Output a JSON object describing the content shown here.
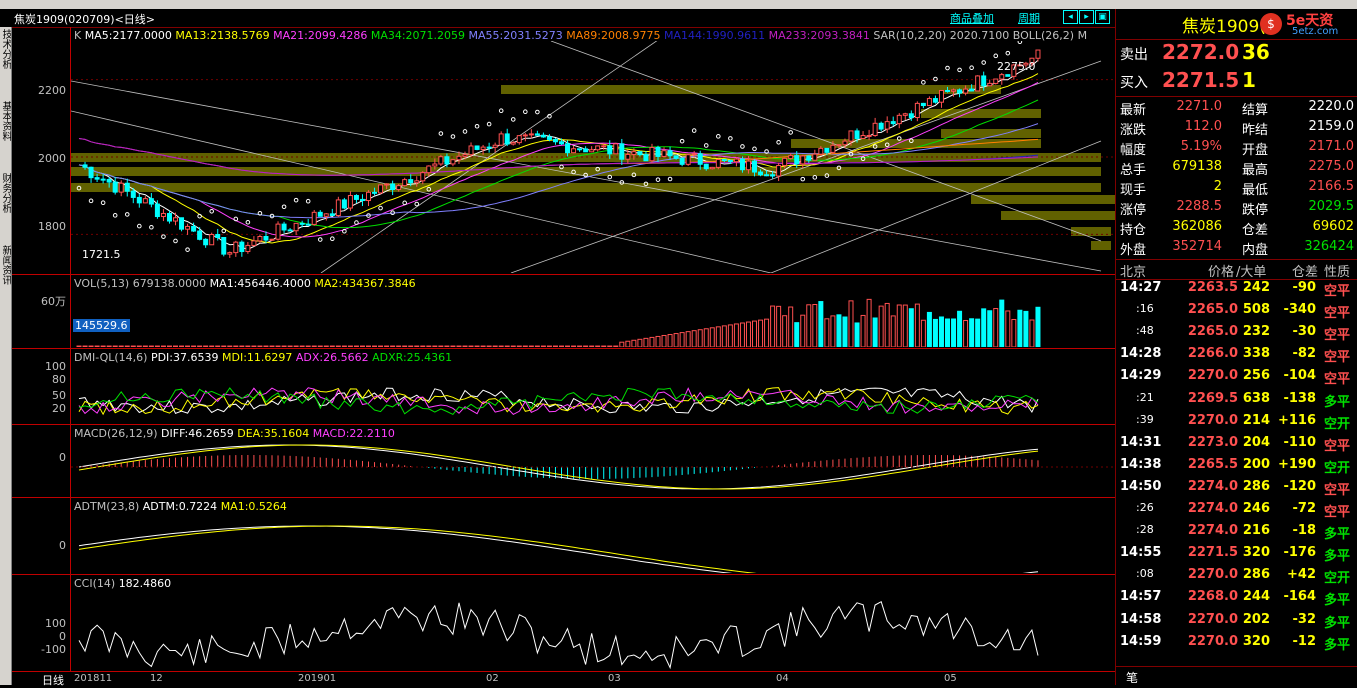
{
  "title": {
    "name": "焦炭1909",
    "code": "(020709)",
    "period": "<日线>"
  },
  "toolbar": {
    "product_overlay": "商品叠加",
    "cycle": "周期"
  },
  "sidebar": {
    "tabs": [
      "技术分析",
      "基本资料",
      "财务分析",
      "新闻资讯"
    ]
  },
  "main_chart": {
    "indicator_line": [
      {
        "text": "K",
        "color": "#c0c0c0"
      },
      {
        "text": "MA5:2177.0000",
        "color": "#ffffff"
      },
      {
        "text": "MA13:2138.5769",
        "color": "#ffff00"
      },
      {
        "text": "MA21:2099.4286",
        "color": "#ff40ff"
      },
      {
        "text": "MA34:2071.2059",
        "color": "#00e000"
      },
      {
        "text": "MA55:2031.5273",
        "color": "#8080ff"
      },
      {
        "text": "MA89:2008.9775",
        "color": "#ff8000"
      },
      {
        "text": "MA144:1990.9611",
        "color": "#2020c0"
      },
      {
        "text": "MA233:2093.3841",
        "color": "#c020c0"
      },
      {
        "text": "SAR(10,2,20) 2020.7100",
        "color": "#c0c0c0"
      },
      {
        "text": "BOLL(26,2) M",
        "color": "#c0c0c0"
      }
    ],
    "y_ticks": [
      "2200",
      "2000",
      "1800"
    ],
    "high_label": "2275.0",
    "low_label": "1721.5"
  },
  "volume": {
    "header": "VOL(5,13) 679138.0000",
    "ma1": "MA1:456446.4000",
    "ma2": "MA2:434367.3846",
    "y_tick": "60万",
    "cursor_value": "145529.6"
  },
  "dmi": {
    "header": "DMI-QL(14,6)",
    "pdi": "PDI:37.6539",
    "mdi": "MDI:11.6297",
    "adx": "ADX:26.5662",
    "adxr": "ADXR:25.4361",
    "y_ticks": [
      "100",
      "80",
      "50",
      "20"
    ]
  },
  "macd": {
    "header": "MACD(26,12,9)",
    "diff": "DIFF:46.2659",
    "dea": "DEA:35.1604",
    "macd": "MACD:22.2110",
    "y_tick": "0"
  },
  "adtm": {
    "header": "ADTM(23,8)",
    "adtm": "ADTM:0.7224",
    "ma1": "MA1:0.5264",
    "y_tick": "0"
  },
  "cci": {
    "header": "CCI(14)",
    "value": "182.4860",
    "y_ticks": [
      "100",
      "0",
      "-100"
    ]
  },
  "x_axis": {
    "corner": "日线",
    "labels": [
      "201811",
      "12",
      "201901",
      "02",
      "03",
      "04",
      "05"
    ]
  },
  "quote": {
    "title": "焦炭1909(",
    "logo": "5e天资",
    "logo_sub": "5etz.com",
    "sell_label": "卖出",
    "sell_price": "2272.0",
    "sell_vol": "36",
    "buy_label": "买入",
    "buy_price": "2271.5",
    "buy_vol": "1",
    "fields": [
      [
        "最新",
        "2271.0",
        "red",
        "结算",
        "2220.0",
        "white"
      ],
      [
        "涨跌",
        "112.0",
        "red",
        "昨结",
        "2159.0",
        "white"
      ],
      [
        "幅度",
        "5.19%",
        "red",
        "开盘",
        "2171.0",
        "red"
      ],
      [
        "总手",
        "679138",
        "yellow",
        "最高",
        "2275.0",
        "red"
      ],
      [
        "现手",
        "2",
        "yellow",
        "最低",
        "2166.5",
        "red"
      ],
      [
        "涨停",
        "2288.5",
        "red",
        "跌停",
        "2029.5",
        "green"
      ],
      [
        "持仓",
        "362086",
        "yellow",
        "仓差",
        "69602",
        "yellow"
      ],
      [
        "外盘",
        "352714",
        "red",
        "内盘",
        "326424",
        "green"
      ]
    ],
    "tick_header": [
      "北京",
      "价格",
      "/大单",
      "仓差",
      "性质"
    ],
    "ticks": [
      [
        "14:27",
        "2263.5",
        "242",
        "-90",
        "空平",
        "red"
      ],
      [
        ":16",
        "2265.0",
        "508",
        "-340",
        "空平",
        "red"
      ],
      [
        ":48",
        "2265.0",
        "232",
        "-30",
        "空平",
        "red"
      ],
      [
        "14:28",
        "2266.0",
        "338",
        "-82",
        "空平",
        "red"
      ],
      [
        "14:29",
        "2270.0",
        "256",
        "-104",
        "空平",
        "red"
      ],
      [
        ":21",
        "2269.5",
        "638",
        "-138",
        "多平",
        "green"
      ],
      [
        ":39",
        "2270.0",
        "214",
        "+116",
        "空开",
        "green"
      ],
      [
        "14:31",
        "2273.0",
        "204",
        "-110",
        "空平",
        "red"
      ],
      [
        "14:38",
        "2265.5",
        "200",
        "+190",
        "空开",
        "green"
      ],
      [
        "14:50",
        "2274.0",
        "286",
        "-120",
        "空平",
        "red"
      ],
      [
        ":26",
        "2274.0",
        "246",
        "-72",
        "空平",
        "red"
      ],
      [
        ":28",
        "2274.0",
        "216",
        "-18",
        "多平",
        "green"
      ],
      [
        "14:55",
        "2271.5",
        "320",
        "-176",
        "多平",
        "green"
      ],
      [
        ":08",
        "2270.0",
        "286",
        "+42",
        "空开",
        "green"
      ],
      [
        "14:57",
        "2268.0",
        "244",
        "-164",
        "多平",
        "green"
      ],
      [
        "14:58",
        "2270.0",
        "202",
        "-32",
        "多平",
        "green"
      ],
      [
        "14:59",
        "2270.0",
        "320",
        "-12",
        "多平",
        "green"
      ]
    ],
    "bottom_label": "笔"
  }
}
